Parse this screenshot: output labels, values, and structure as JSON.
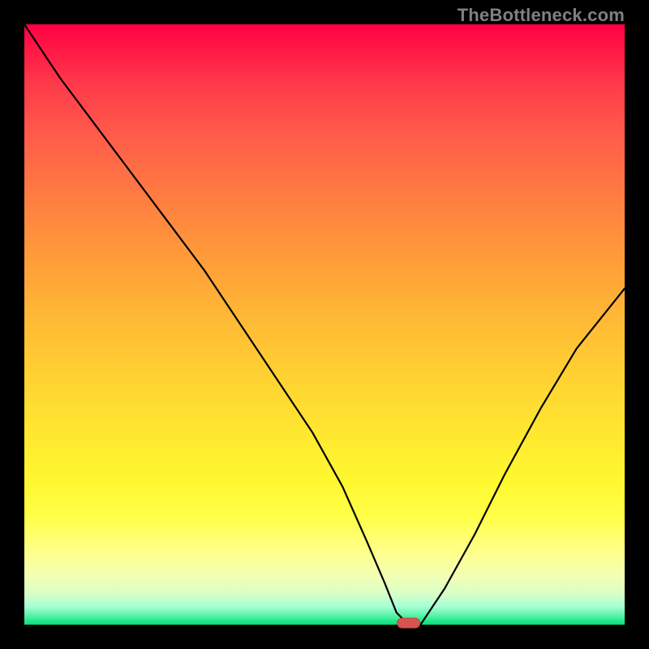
{
  "watermark": "TheBottleneck.com",
  "chart_data": {
    "type": "line",
    "title": "",
    "xlabel": "",
    "ylabel": "",
    "xlim": [
      0,
      100
    ],
    "ylim": [
      0,
      100
    ],
    "grid": false,
    "legend": false,
    "background_gradient": {
      "top": "#ff0044",
      "bottom": "#00e07a",
      "description": "vertical red-to-green gradient (bottleneck chart background)"
    },
    "series": [
      {
        "name": "bottleneck-curve",
        "x": [
          0,
          6,
          12,
          18,
          24,
          30,
          36,
          42,
          48,
          53,
          57,
          60,
          62,
          64,
          66,
          70,
          75,
          80,
          86,
          92,
          100
        ],
        "y": [
          100,
          91,
          83,
          75,
          67,
          59,
          50,
          41,
          32,
          23,
          14,
          7,
          2,
          0,
          0,
          6,
          15,
          25,
          36,
          46,
          56
        ],
        "stroke": "#000000"
      }
    ],
    "marker": {
      "name": "optimal-point",
      "shape": "rounded-rect",
      "x": 64,
      "y": 0,
      "color": "#d9534f"
    }
  }
}
